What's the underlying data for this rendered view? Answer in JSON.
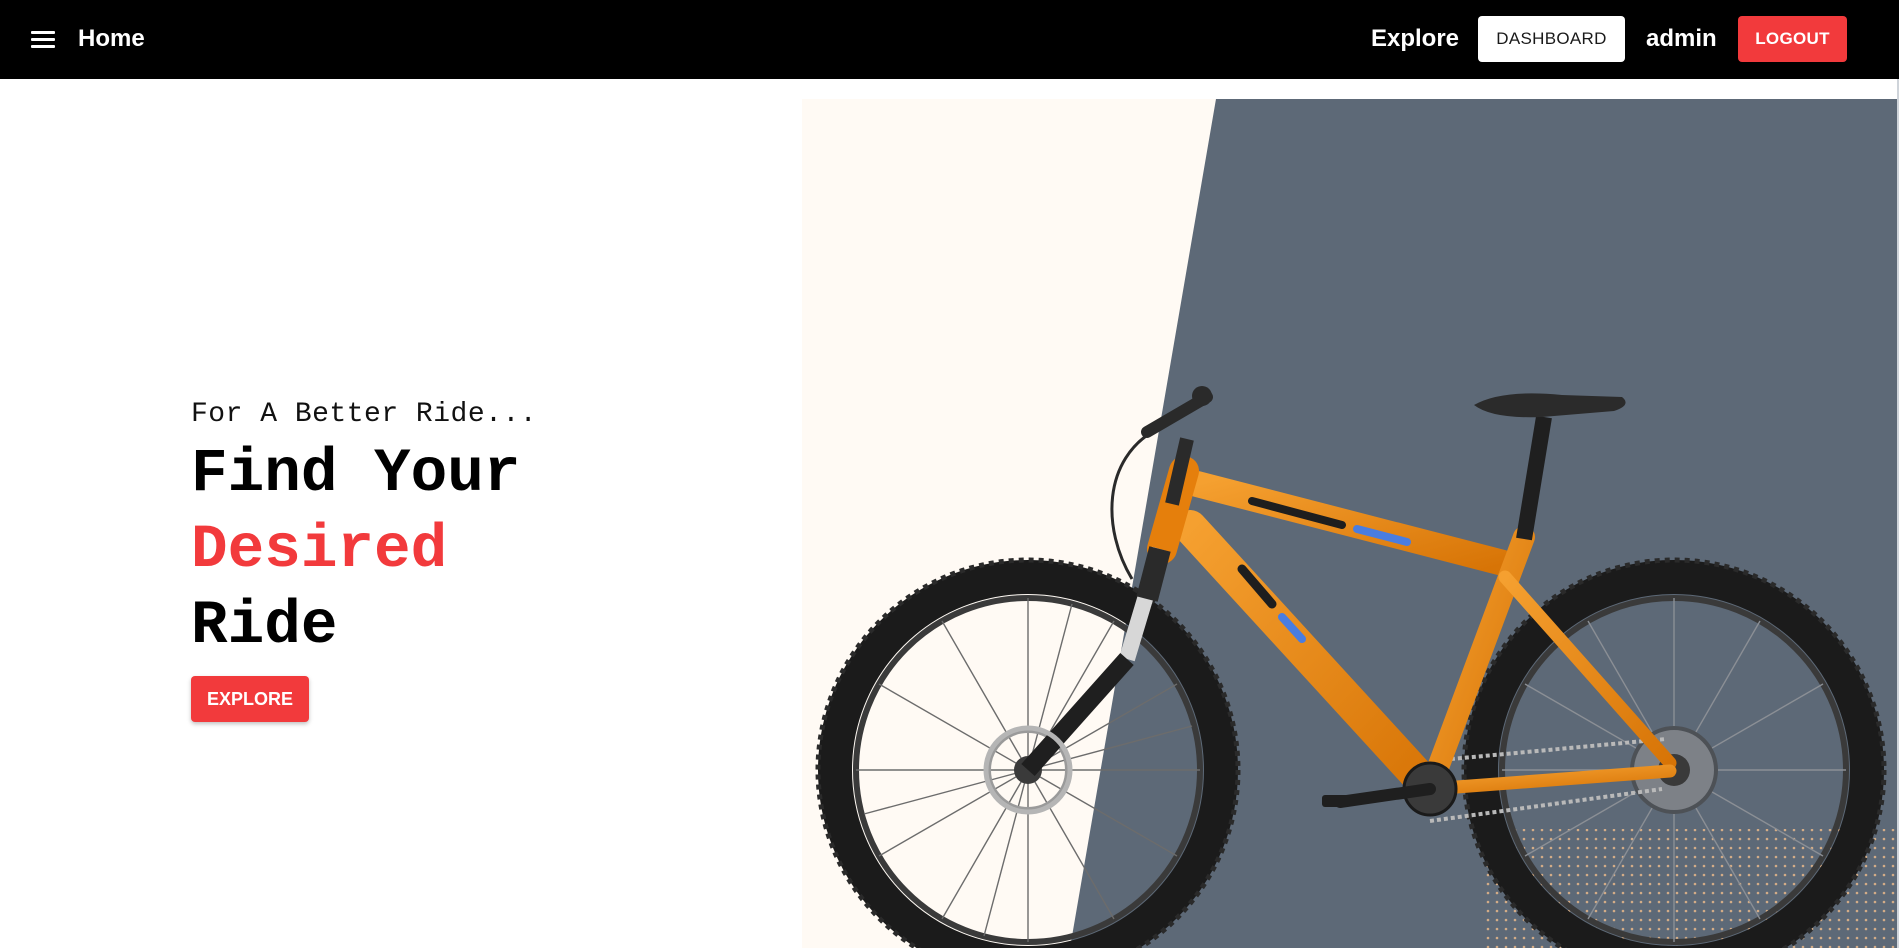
{
  "navbar": {
    "menu_icon": "hamburger-menu-icon",
    "home_label": "Home",
    "explore_label": "Explore",
    "dashboard_label": "DASHBOARD",
    "user_label": "admin",
    "logout_label": "LOGOUT"
  },
  "hero": {
    "tagline": "For A Better Ride...",
    "headline_line1": "Find Your",
    "headline_line2": "Desired",
    "headline_line3": "Ride",
    "explore_button_label": "EXPLORE",
    "image_subject": "orange-mountain-bike"
  },
  "colors": {
    "navbar_bg": "#000000",
    "accent": "#f23a3c",
    "image_bg_light": "#fffaf4",
    "image_bg_dark": "#5d6977",
    "bike_frame": "#ef8a12",
    "dot_pattern": "#e8b88a"
  }
}
